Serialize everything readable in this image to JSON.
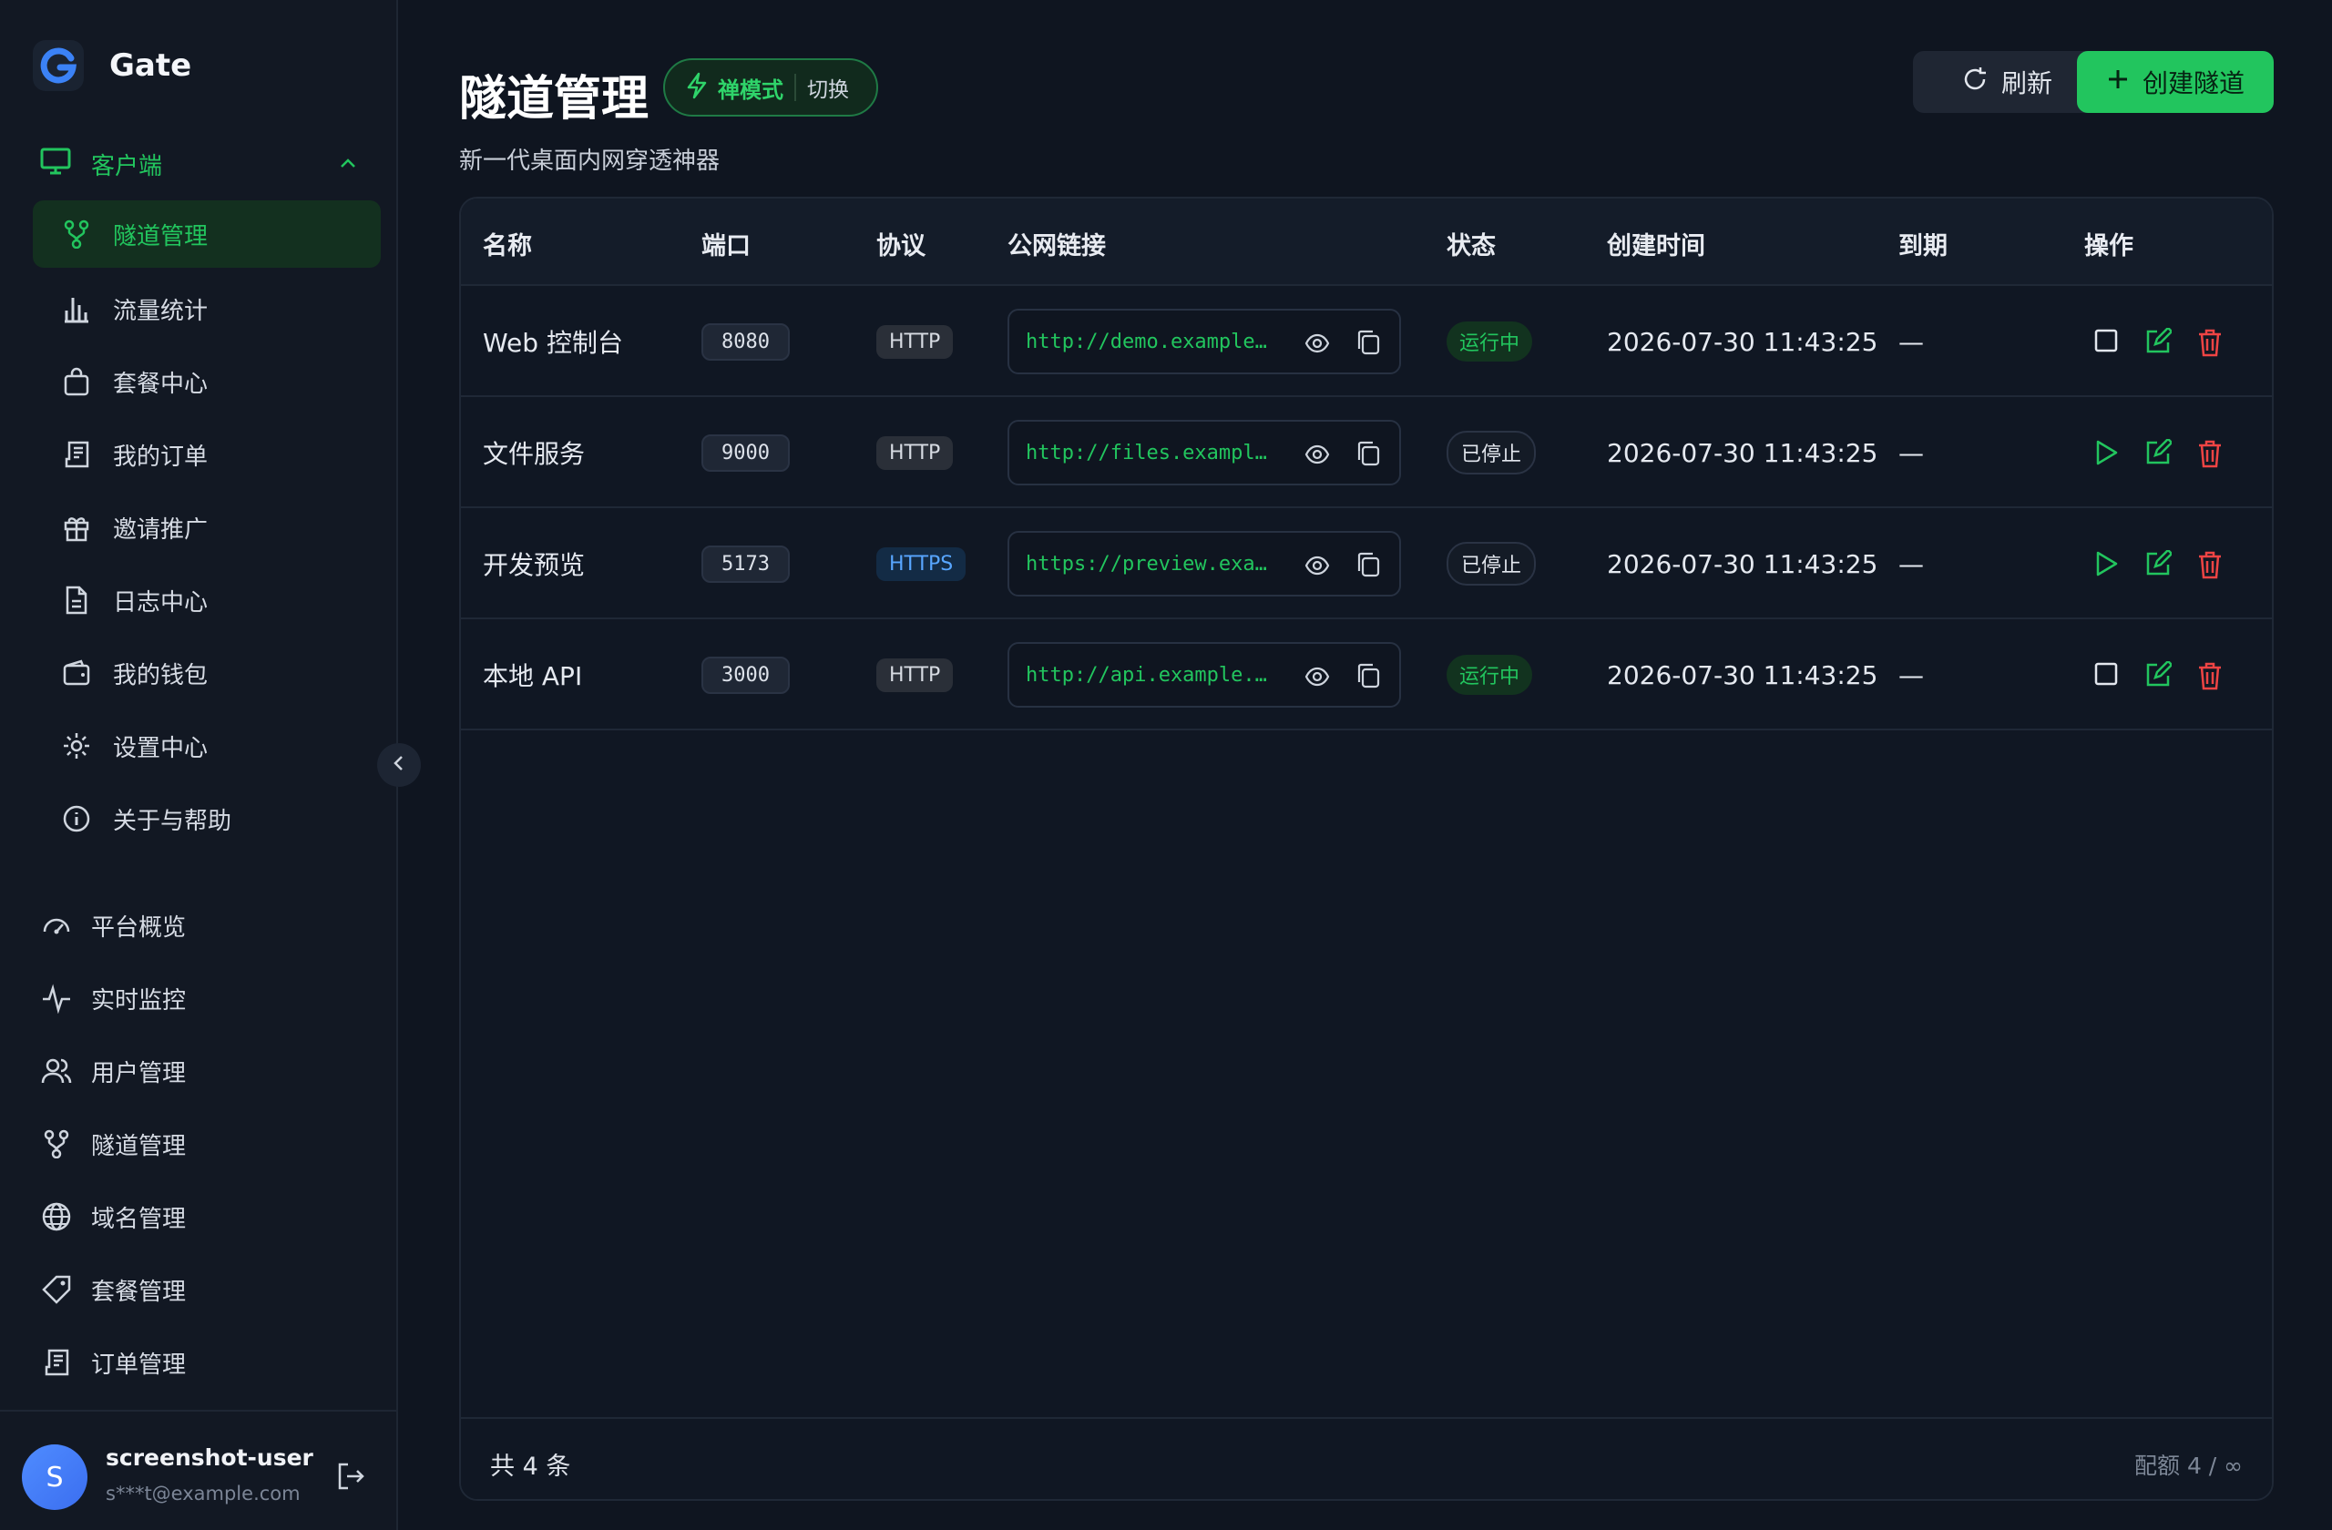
{
  "app": {
    "name": "Gate"
  },
  "sidebar": {
    "client_group": {
      "label": "客户端"
    },
    "client_items": [
      {
        "label": "隧道管理",
        "icon": "fork-icon"
      },
      {
        "label": "流量统计",
        "icon": "bar-chart-icon"
      },
      {
        "label": "套餐中心",
        "icon": "bag-icon"
      },
      {
        "label": "我的订单",
        "icon": "receipt-icon"
      },
      {
        "label": "邀请推广",
        "icon": "gift-icon"
      },
      {
        "label": "日志中心",
        "icon": "file-icon"
      },
      {
        "label": "我的钱包",
        "icon": "wallet-icon"
      },
      {
        "label": "设置中心",
        "icon": "gear-icon"
      },
      {
        "label": "关于与帮助",
        "icon": "info-icon"
      }
    ],
    "admin_items": [
      {
        "label": "平台概览",
        "icon": "gauge-icon"
      },
      {
        "label": "实时监控",
        "icon": "activity-icon"
      },
      {
        "label": "用户管理",
        "icon": "users-icon"
      },
      {
        "label": "隧道管理",
        "icon": "fork-icon"
      },
      {
        "label": "域名管理",
        "icon": "globe-icon"
      },
      {
        "label": "套餐管理",
        "icon": "tag-icon"
      },
      {
        "label": "订单管理",
        "icon": "receipt-icon"
      }
    ],
    "user": {
      "initial": "S",
      "name": "screenshot-user",
      "email": "s***t@example.com"
    }
  },
  "header": {
    "title": "隧道管理",
    "mode_label": "禅模式",
    "mode_switch": "切换",
    "subtitle": "新一代桌面内网穿透神器",
    "refresh_label": "刷新",
    "create_label": "创建隧道"
  },
  "table": {
    "columns": [
      "名称",
      "端口",
      "协议",
      "公网链接",
      "状态",
      "创建时间",
      "到期",
      "操作"
    ],
    "rows": [
      {
        "name": "Web 控制台",
        "port": "8080",
        "protocol": "HTTP",
        "url": "http://demo.example.com",
        "status": "运行中",
        "running": true,
        "created": "2026-07-30 11:43:25",
        "expire": "—"
      },
      {
        "name": "文件服务",
        "port": "9000",
        "protocol": "HTTP",
        "url": "http://files.example.com",
        "status": "已停止",
        "running": false,
        "created": "2026-07-30 11:43:25",
        "expire": "—"
      },
      {
        "name": "开发预览",
        "port": "5173",
        "protocol": "HTTPS",
        "url": "https://preview.example.com",
        "status": "已停止",
        "running": false,
        "created": "2026-07-30 11:43:25",
        "expire": "—"
      },
      {
        "name": "本地 API",
        "port": "3000",
        "protocol": "HTTP",
        "url": "http://api.example.com",
        "status": "运行中",
        "running": true,
        "created": "2026-07-30 11:43:25",
        "expire": "—"
      }
    ],
    "total": "共 4 条",
    "quota": "配额 4 / ∞"
  },
  "colors": {
    "accent": "#22c55e",
    "danger": "#ef4444",
    "info": "#58a6ff",
    "background": "#0f1520"
  }
}
